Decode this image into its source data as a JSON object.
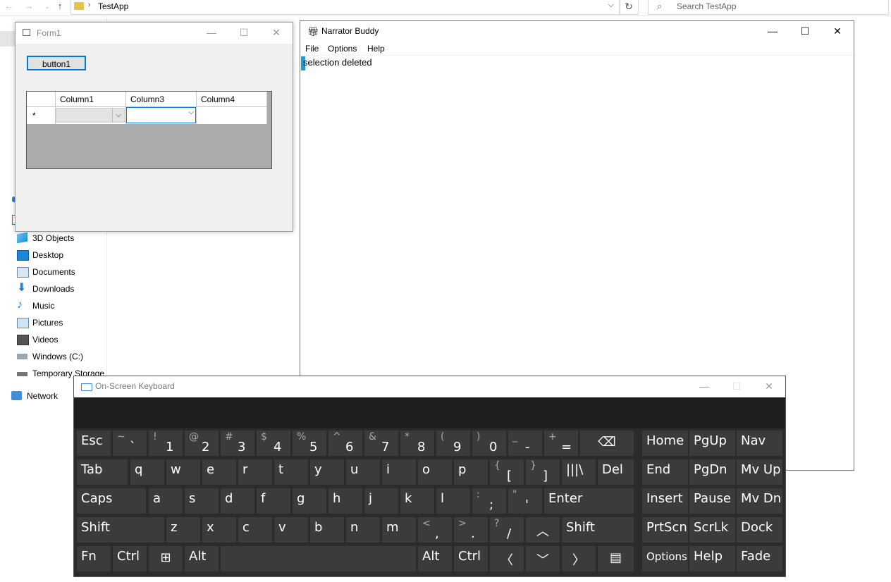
{
  "explorer": {
    "breadcrumb": "TestApp",
    "search_placeholder": "Search TestApp",
    "nav_items": [
      {
        "label": "3D Objects",
        "icon": "3d-objects-icon"
      },
      {
        "label": "Desktop",
        "icon": "desktop-icon"
      },
      {
        "label": "Documents",
        "icon": "documents-icon"
      },
      {
        "label": "Downloads",
        "icon": "downloads-icon"
      },
      {
        "label": "Music",
        "icon": "music-icon"
      },
      {
        "label": "Pictures",
        "icon": "pictures-icon"
      },
      {
        "label": "Videos",
        "icon": "videos-icon"
      },
      {
        "label": "Windows (C:)",
        "icon": "drive-icon"
      },
      {
        "label": "Temporary Storage",
        "icon": "drive-icon"
      },
      {
        "label": "Network",
        "icon": "network-icon"
      }
    ]
  },
  "form1": {
    "title": "Form1",
    "button_label": "button1",
    "columns": [
      "Column1",
      "Column3",
      "Column4"
    ],
    "new_row_marker": "*"
  },
  "narrator": {
    "title": "Narrator Buddy",
    "menu": [
      "File",
      "Options",
      "Help"
    ],
    "text": "selection deleted"
  },
  "osk": {
    "title": "On-Screen Keyboard",
    "rows": [
      [
        "Esc",
        "~|`",
        "!|1",
        "@|2",
        "#|3",
        "$|4",
        "%|5",
        "^|6",
        "&|7",
        "*|8",
        "(|9",
        ")|0",
        "_|-",
        "+|=",
        "⌫",
        "Home",
        "PgUp",
        "Nav"
      ],
      [
        "Tab",
        "q",
        "w",
        "e",
        "r",
        "t",
        "y",
        "u",
        "i",
        "o",
        "p",
        "{|[",
        "}|]",
        "|||\\",
        "Del",
        "End",
        "PgDn",
        "Mv Up"
      ],
      [
        "Caps",
        "a",
        "s",
        "d",
        "f",
        "g",
        "h",
        "j",
        "k",
        "l",
        ":|;",
        "\"|'",
        "Enter",
        "Insert",
        "Pause",
        "Mv Dn"
      ],
      [
        "Shift",
        "z",
        "x",
        "c",
        "v",
        "b",
        "n",
        "m",
        "<|,",
        ">|.",
        "?|/",
        "︿",
        "Shift",
        "PrtScn",
        "ScrLk",
        "Dock"
      ],
      [
        "Fn",
        "Ctrl",
        "⊞",
        "Alt",
        "",
        "Alt",
        "Ctrl",
        "〈",
        "﹀",
        "〉",
        "▤",
        "Options",
        "Help",
        "Fade"
      ]
    ]
  }
}
